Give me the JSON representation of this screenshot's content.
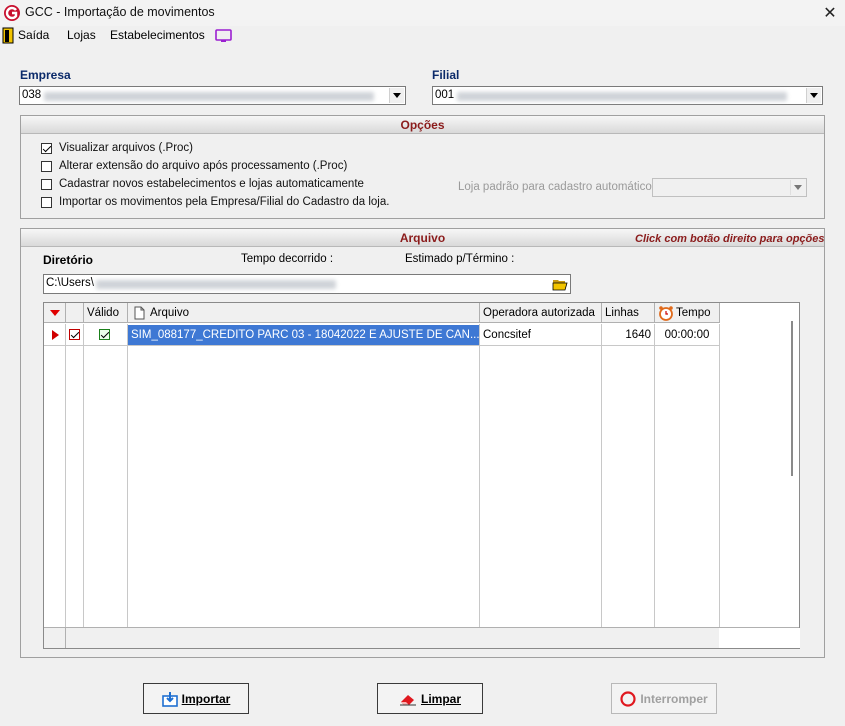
{
  "window": {
    "title": "GCC - Importação de movimentos"
  },
  "menu": {
    "exit": "Saída",
    "stores": "Lojas",
    "establishments": "Estabelecimentos"
  },
  "empresa": {
    "label": "Empresa",
    "value": "038"
  },
  "filial": {
    "label": "Filial",
    "value": "001"
  },
  "opcoes": {
    "title": "Opções",
    "options": [
      {
        "label": "Visualizar arquivos (.Proc)",
        "checked": true
      },
      {
        "label": "Alterar extensão do arquivo após processamento (.Proc)",
        "checked": false
      },
      {
        "label": "Cadastrar novos estabelecimentos e lojas automaticamente",
        "checked": false
      },
      {
        "label": "Importar os movimentos pela Empresa/Filial do Cadastro da loja.",
        "checked": false
      }
    ],
    "default_store_label": "Loja padrão para cadastro automático"
  },
  "arquivo": {
    "title": "Arquivo",
    "hint": "Click com botão direito para opções",
    "dir_label": "Diretório",
    "elapsed_label": "Tempo decorrido :",
    "eta_label": "Estimado p/Término :",
    "dir_value": "C:\\Users\\"
  },
  "grid": {
    "headers": {
      "valid": "Válido",
      "file": "Arquivo",
      "operator": "Operadora autorizada",
      "lines": "Linhas",
      "time": "Tempo"
    },
    "rows": [
      {
        "file": "SIM_088177_CREDITO PARC 03 - 18042022 E AJUSTE DE CAN...",
        "operator": "Concsitef",
        "lines": "1640",
        "time": "00:00:00"
      }
    ]
  },
  "buttons": {
    "import": "Importar",
    "clear": "Limpar",
    "stop": "Interromper"
  },
  "colors": {
    "selection": "#3e78d4",
    "group_title": "#8b1c1c",
    "label": "#0b2a6a"
  }
}
